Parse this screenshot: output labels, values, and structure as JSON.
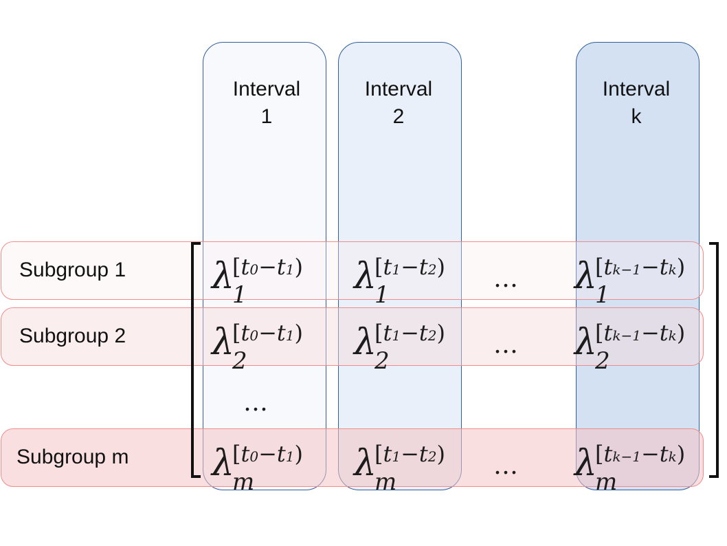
{
  "intervals": [
    {
      "label": "Interval\n1"
    },
    {
      "label": "Interval\n2"
    },
    {
      "label": "Interval\nk"
    }
  ],
  "subgroups": [
    {
      "label": "Subgroup 1"
    },
    {
      "label": "Subgroup 2"
    },
    {
      "label": "Subgroup m"
    }
  ],
  "symbol": "λ",
  "row_subscripts": [
    "1",
    "2",
    "m"
  ],
  "interval_superscripts": [
    {
      "a": "t",
      "a_sub": "0",
      "b": "t",
      "b_sub": "1"
    },
    {
      "a": "t",
      "a_sub": "1",
      "b": "t",
      "b_sub": "2"
    },
    {
      "a": "t",
      "a_sub": "k−1",
      "b": "t",
      "b_sub": "k"
    }
  ],
  "ellipsis": "…"
}
